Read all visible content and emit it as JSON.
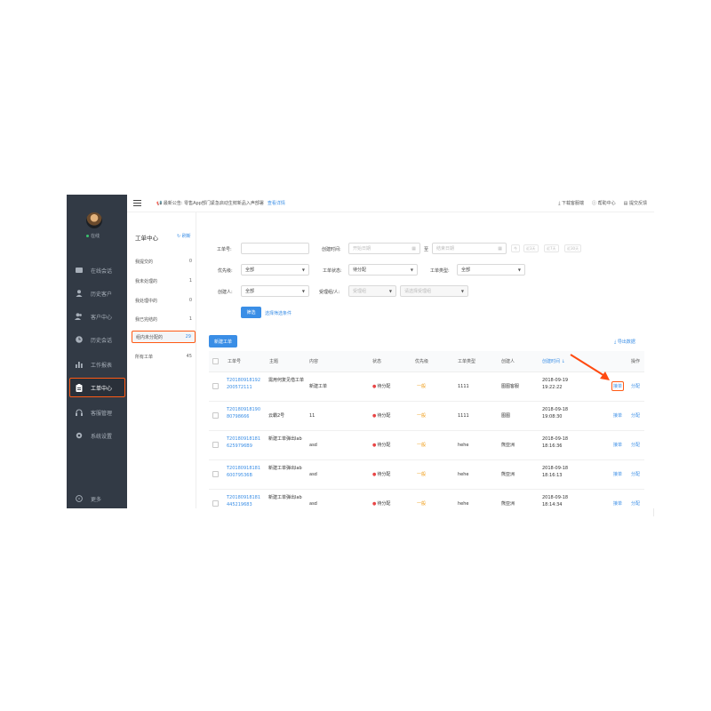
{
  "nav": {
    "status": "在线",
    "items": [
      {
        "label": "在线会话",
        "icon": "chat-icon"
      },
      {
        "label": "历史客户",
        "icon": "user-icon"
      },
      {
        "label": "客户中心",
        "icon": "users-icon"
      },
      {
        "label": "历史会话",
        "icon": "clock-icon"
      },
      {
        "label": "工作报表",
        "icon": "bar-chart-icon"
      },
      {
        "label": "工单中心",
        "icon": "clipboard-icon"
      },
      {
        "label": "客服管理",
        "icon": "headset-icon"
      },
      {
        "label": "系统设置",
        "icon": "gear-icon"
      }
    ],
    "more": "更多"
  },
  "col2": {
    "title": "工单中心",
    "refresh": "刷新",
    "queues": [
      {
        "label": "我提交的",
        "count": "0"
      },
      {
        "label": "我未处理的",
        "count": "1"
      },
      {
        "label": "我处理中的",
        "count": "0"
      },
      {
        "label": "我已完结的",
        "count": "1"
      },
      {
        "label": "组内未分配的",
        "count": "29"
      },
      {
        "label": "所有工单",
        "count": "45"
      }
    ]
  },
  "topbar": {
    "notice": "最新公告: 零售App部门紧急启动生鲜新品入声部署",
    "notice_more": "查看详情",
    "actions": [
      "下载客服端",
      "帮助中心",
      "提交反馈"
    ]
  },
  "filter": {
    "ticket_no_label": "工单号:",
    "created_time_label": "创建时间:",
    "start_placeholder": "开始日期",
    "to": "至",
    "end_placeholder": "结束日期",
    "quick": [
      "今",
      "近3天",
      "近7天",
      "近30天"
    ],
    "priority_label": "优先级:",
    "priority_value": "全部",
    "status_label": "工单状态:",
    "status_value": "待分配",
    "type_label": "工单类型:",
    "type_value": "全部",
    "creator_label": "创建人:",
    "creator_value": "全部",
    "handler_label": "受理组/人:",
    "handler_group_placeholder": "受理组",
    "handler_person_placeholder": "请选择受理组",
    "search_button": "筛选",
    "choose_conditions": "选择筛选条件"
  },
  "toolbar": {
    "new_ticket": "新建工单",
    "export": "导出数据"
  },
  "table": {
    "headers": [
      "工单号",
      "主题",
      "内容",
      "状态",
      "优先级",
      "工单类型",
      "创建人",
      "创建时间",
      "操作"
    ],
    "rows": [
      {
        "id": "T20180918192200572111",
        "subject": "需用何复见借工单",
        "content": "新建工单",
        "status": "待分配",
        "priority": "一般",
        "type": "1111",
        "creator": "图图客服",
        "time": "2018-09-19 19:22:22",
        "op1": "接单",
        "op2": "分配"
      },
      {
        "id": "T2018091819080798666",
        "subject": "云霸2号",
        "content": "11",
        "status": "待分配",
        "priority": "一般",
        "type": "1111",
        "creator": "图图",
        "time": "2018-09-18 19:08:30",
        "op1": "接单",
        "op2": "分配"
      },
      {
        "id": "T201809181816259796B9",
        "subject": "新建工单弹出lab",
        "content": "asd",
        "status": "待分配",
        "priority": "一般",
        "type": "hehe",
        "creator": "熊亚洲",
        "time": "2018-09-18 18:16:36",
        "op1": "接单",
        "op2": "分配"
      },
      {
        "id": "T2018091818160079536B",
        "subject": "新建工单弹出lab",
        "content": "asd",
        "status": "待分配",
        "priority": "一般",
        "type": "hehe",
        "creator": "熊亚洲",
        "time": "2018-09-18 18:16:13",
        "op1": "接单",
        "op2": "分配"
      },
      {
        "id": "T20180918181445219683",
        "subject": "新建工单弹出lab",
        "content": "asd",
        "status": "待分配",
        "priority": "一般",
        "type": "hehe",
        "creator": "熊亚洲",
        "time": "2018-09-18 18:14:34",
        "op1": "接单",
        "op2": "分配"
      }
    ]
  },
  "colors": {
    "accent": "#3a8ee6",
    "highlight": "#ff5a14",
    "nav_bg": "#323a45"
  }
}
